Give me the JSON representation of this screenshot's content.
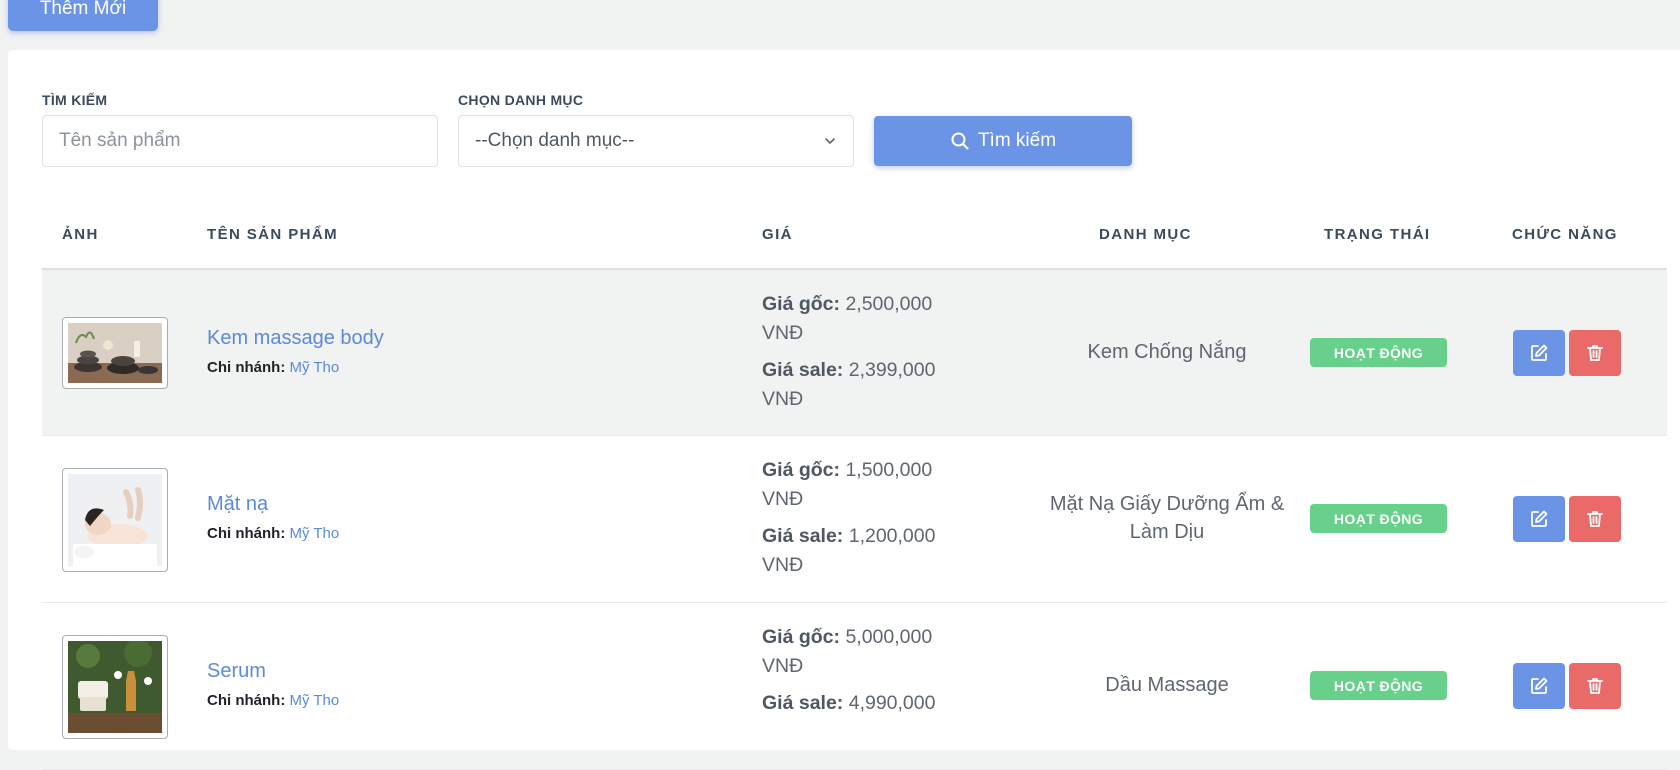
{
  "toolbar": {
    "add_new_label": "Thêm Mới"
  },
  "filters": {
    "search_label": "TÌM KIẾM",
    "search_placeholder": "Tên sản phẩm",
    "category_label": "CHỌN DANH MỤC",
    "category_selected": "--Chọn danh mục--",
    "search_button": "Tìm kiếm"
  },
  "table": {
    "columns": [
      "ẢNH",
      "TÊN SẢN PHẨM",
      "GIÁ",
      "DANH MỤC",
      "TRẠNG THÁI",
      "CHỨC NĂNG"
    ],
    "branch_label": "Chi nhánh:",
    "price_original_label": "Giá gốc:",
    "price_sale_label": "Giá sale:",
    "currency": "VNĐ",
    "rows": [
      {
        "name": "Kem massage body",
        "branch": "Mỹ Tho",
        "price_original": "2,500,000",
        "price_sale": "2,399,000",
        "category_line1": "Kem Chống Nắng",
        "category_line2": "",
        "status": "HOẠT ĐỘNG",
        "image": "massage-stones-photo",
        "highlighted": true
      },
      {
        "name": "Mặt nạ",
        "branch": "Mỹ Tho",
        "price_original": "1,500,000",
        "price_sale": "1,200,000",
        "category_line1": "Mặt Nạ Giấy Dưỡng Ẩm &",
        "category_line2": "Làm Dịu",
        "status": "HOẠT ĐỘNG",
        "image": "facial-spa-photo",
        "highlighted": false
      },
      {
        "name": "Serum",
        "branch": "Mỹ Tho",
        "price_original": "5,000,000",
        "price_sale": "4,990,000",
        "category_line1": "Dầu Massage",
        "category_line2": "",
        "status": "HOẠT ĐỘNG",
        "image": "spa-oils-photo",
        "highlighted": false
      }
    ]
  },
  "icons": {
    "search": "search-icon",
    "chevron": "chevron-down-icon",
    "edit": "edit-icon",
    "delete": "trash-icon"
  },
  "colors": {
    "primary": "#6b94e6",
    "danger": "#ea6a6a",
    "success": "#67d08a",
    "link": "#5b8ad9"
  }
}
